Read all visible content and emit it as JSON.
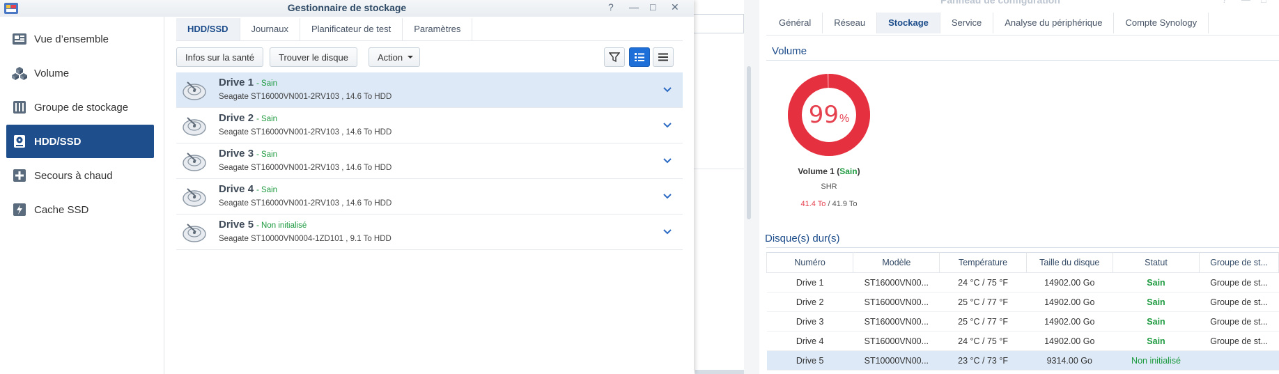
{
  "control_panel": {
    "title": "Panneau de configuration",
    "tabs": [
      "Général",
      "Réseau",
      "Stockage",
      "Service",
      "Analyse du périphérique",
      "Compte Synology"
    ],
    "active_tab": "Stockage",
    "volume_section": "Volume",
    "volume": {
      "percent": "99",
      "percent_sign": "%",
      "usage_fraction": 0.99,
      "name": "Volume 1",
      "status": "Sain",
      "type": "SHR",
      "used": "41.4 To",
      "separator": "/",
      "total": "41.9 To"
    },
    "disks_section": "Disque(s) dur(s)",
    "disk_table": {
      "headers": [
        "Numéro",
        "Modèle",
        "Température",
        "Taille du disque",
        "Statut",
        "Groupe de st..."
      ],
      "rows": [
        {
          "num": "Drive 1",
          "model": "ST16000VN00...",
          "temp": "24 °C / 75 °F",
          "size": "14902.00 Go",
          "status": "Sain",
          "group": "Groupe de st..."
        },
        {
          "num": "Drive 2",
          "model": "ST16000VN00...",
          "temp": "25 °C / 77 °F",
          "size": "14902.00 Go",
          "status": "Sain",
          "group": "Groupe de st..."
        },
        {
          "num": "Drive 3",
          "model": "ST16000VN00...",
          "temp": "25 °C / 77 °F",
          "size": "14902.00 Go",
          "status": "Sain",
          "group": "Groupe de st..."
        },
        {
          "num": "Drive 4",
          "model": "ST16000VN00...",
          "temp": "24 °C / 75 °F",
          "size": "14902.00 Go",
          "status": "Sain",
          "group": "Groupe de st..."
        },
        {
          "num": "Drive 5",
          "model": "ST10000VN00...",
          "temp": "23 °C / 73 °F",
          "size": "9314.00 Go",
          "status": "Non initialisé",
          "group": ""
        }
      ]
    }
  },
  "storage_manager": {
    "title": "Gestionnaire de stockage",
    "window_controls": {
      "help": "?",
      "minimize": "—",
      "maximize": "□",
      "close": "✕"
    },
    "sidebar": [
      {
        "label": "Vue d’ensemble",
        "icon": "overview-icon"
      },
      {
        "label": "Volume",
        "icon": "volume-icon"
      },
      {
        "label": "Groupe de stockage",
        "icon": "storage-pool-icon"
      },
      {
        "label": "HDD/SSD",
        "icon": "hdd-icon"
      },
      {
        "label": "Secours à chaud",
        "icon": "hot-spare-icon"
      },
      {
        "label": "Cache SSD",
        "icon": "ssd-cache-icon"
      }
    ],
    "active_sidebar": "HDD/SSD",
    "tabs": [
      "HDD/SSD",
      "Journaux",
      "Planificateur de test",
      "Paramètres"
    ],
    "active_tab": "HDD/SSD",
    "toolbar": {
      "health_info": "Infos sur la santé",
      "find_disk": "Trouver le disque",
      "action": "Action"
    },
    "drives": [
      {
        "name": "Drive 1",
        "status": "Sain",
        "desc": "Seagate ST16000VN001-2RV103 , 14.6 To HDD"
      },
      {
        "name": "Drive 2",
        "status": "Sain",
        "desc": "Seagate ST16000VN001-2RV103 , 14.6 To HDD"
      },
      {
        "name": "Drive 3",
        "status": "Sain",
        "desc": "Seagate ST16000VN001-2RV103 , 14.6 To HDD"
      },
      {
        "name": "Drive 4",
        "status": "Sain",
        "desc": "Seagate ST16000VN001-2RV103 , 14.6 To HDD"
      },
      {
        "name": "Drive 5",
        "status": "Non initialisé",
        "desc": "Seagate ST10000VN0004-1ZD101 , 9.1 To HDD"
      }
    ],
    "dash": "-",
    "colors": {
      "accent": "#1f4e8c",
      "ok": "#1d9a3f",
      "danger": "#e5414f",
      "selected_row": "#dde9f7"
    }
  }
}
